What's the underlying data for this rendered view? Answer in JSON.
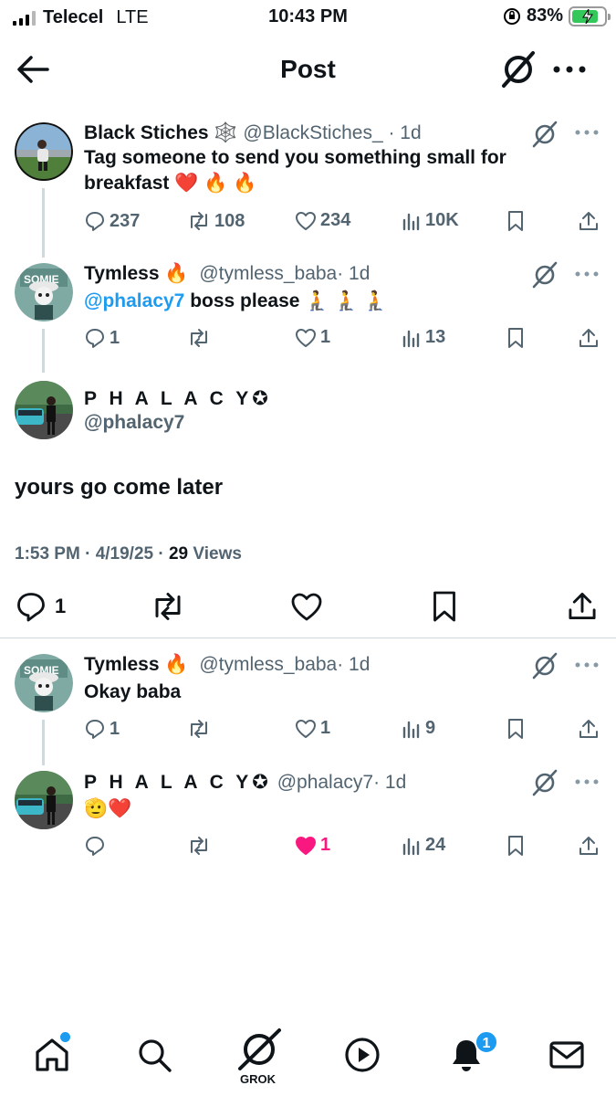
{
  "status_bar": {
    "carrier": "Telecel",
    "network": "LTE",
    "time": "10:43 PM",
    "battery": "83%",
    "battery_level": 0.83
  },
  "header": {
    "title": "Post"
  },
  "tweets": [
    {
      "name": "Black Stiches",
      "name_emoji": "🕸️",
      "handle": "@BlackStiches_",
      "time": "· 1d",
      "text": "Tag someone to send you something small for breakfast ❤️ 🔥 🔥",
      "replies": "237",
      "reposts": "108",
      "likes": "234",
      "views": "10K"
    },
    {
      "name": "Tymless",
      "name_emoji": "🔥",
      "handle": "@tymless_baba",
      "time": "· 1d",
      "mention": "@phalacy7",
      "text": " boss please 🧎 🧎 🧎",
      "replies": "1",
      "reposts": "",
      "likes": "1",
      "views": "13"
    }
  ],
  "main_post": {
    "name": "P H A L A C Y✪",
    "handle": "@phalacy7",
    "text": "yours go come later",
    "timestamp": "1:53 PM · 4/19/25 · ",
    "views_count": "29",
    "views_label": " Views",
    "replies": "1"
  },
  "replies": [
    {
      "name": "Tymless",
      "name_emoji": "🔥",
      "handle": "@tymless_baba",
      "time": "· 1d",
      "text": "Okay baba",
      "replies": "1",
      "reposts": "",
      "likes": "1",
      "views": "9"
    },
    {
      "name": "P H A L A C Y✪",
      "handle": "@phalacy7",
      "time": "· 1d",
      "text": "🫡❤️",
      "replies": "",
      "reposts": "",
      "likes": "1",
      "views": "24",
      "liked": true
    }
  ],
  "bottom_nav": {
    "grok_label": "GROK",
    "notifications_badge": "1"
  },
  "colors": {
    "accent": "#1d9bf0",
    "like": "#f91880",
    "muted": "#536471",
    "text": "#0f1419"
  }
}
